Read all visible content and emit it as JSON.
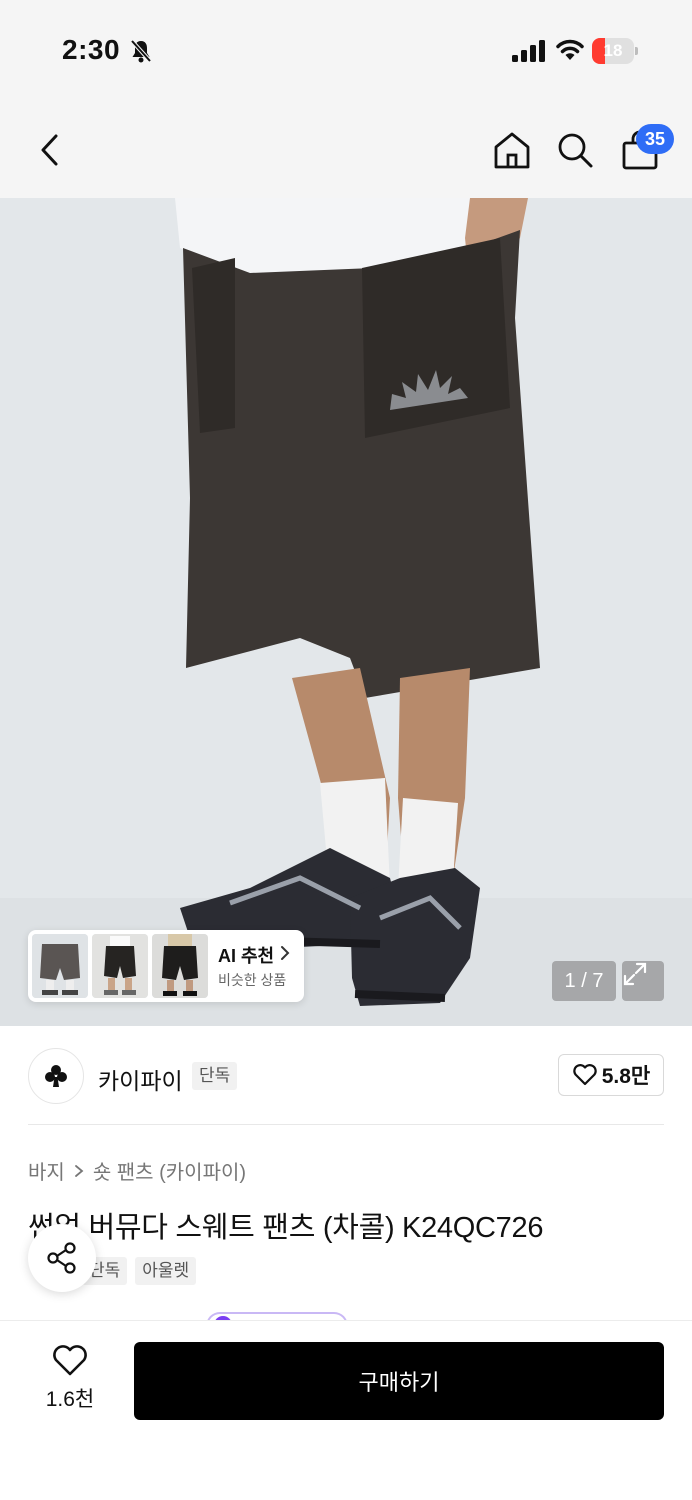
{
  "status_bar": {
    "time": "2:30",
    "battery_level": "18",
    "icons": [
      "bell-off-icon",
      "cellular-signal-icon",
      "wifi-icon",
      "battery-icon"
    ]
  },
  "nav": {
    "icons": [
      "chevron-left-icon",
      "home-icon",
      "search-icon",
      "shopping-bag-icon"
    ],
    "cart_count": "35"
  },
  "gallery": {
    "page_indicator": "1 / 7",
    "ai_recommend": {
      "title": "AI 추천",
      "subtitle": "비슷한 상품"
    }
  },
  "brand": {
    "name": "카이파이",
    "tag": "단독",
    "like_count": "5.8만",
    "logo_icon": "club-icon"
  },
  "product": {
    "breadcrumb": {
      "category": "바지",
      "subcategory": "숏 팬츠 (카이파이)"
    },
    "title": "썬업 버뮤다 스웨트 팬츠 (차콜) K24QC726",
    "tags": [
      "단독",
      "아울렛"
    ]
  },
  "bottom_bar": {
    "wish_count": "1.6천",
    "buy_label": "구매하기"
  },
  "colors": {
    "accent_blue": "#2f6df6",
    "buy_button": "#000000",
    "battery_low": "#ff3b30"
  }
}
